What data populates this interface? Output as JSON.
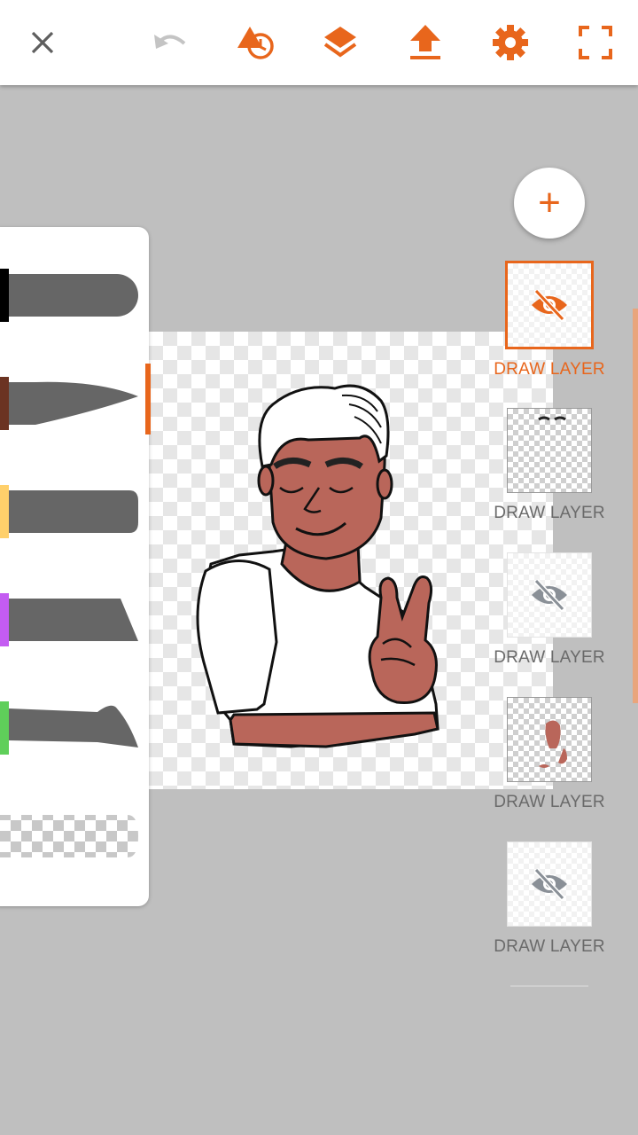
{
  "toolbar": {
    "close_icon": "close-icon",
    "undo_icon": "undo-icon",
    "shapes_icon": "shapes-history-icon",
    "layers_icon": "layers-icon",
    "export_icon": "upload-icon",
    "settings_icon": "gear-icon",
    "fullscreen_icon": "fullscreen-icon"
  },
  "colors": {
    "accent": "#e8661c",
    "icon_gray": "#5f5f5f",
    "disabled": "#c4c4c4",
    "brush_gray": "#666666"
  },
  "brushes": [
    {
      "name": "round-brush",
      "color": "#000000"
    },
    {
      "name": "tapered-brush",
      "color": "#6b3322"
    },
    {
      "name": "marker-brush",
      "color": "#ffd06b"
    },
    {
      "name": "chisel-brush",
      "color": "#c45cf2"
    },
    {
      "name": "ink-brush",
      "color": "#5fcf5a"
    },
    {
      "name": "eraser-brush",
      "color": "transparent"
    }
  ],
  "add_layer_label": "+",
  "layers": [
    {
      "label": "DRAW LAYER",
      "selected": true,
      "visible": false
    },
    {
      "label": "DRAW LAYER",
      "selected": false,
      "visible": true
    },
    {
      "label": "DRAW LAYER",
      "selected": false,
      "visible": false
    },
    {
      "label": "DRAW LAYER",
      "selected": false,
      "visible": true
    },
    {
      "label": "DRAW LAYER",
      "selected": false,
      "visible": false
    }
  ]
}
